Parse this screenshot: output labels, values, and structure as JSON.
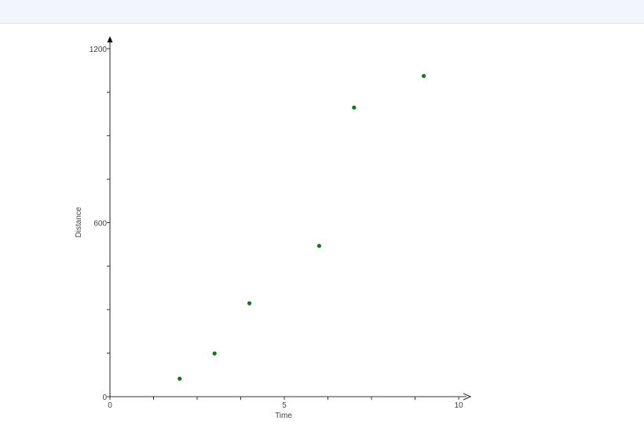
{
  "chart_data": {
    "type": "scatter",
    "title": "",
    "xlabel": "Time",
    "ylabel": "Distance",
    "xlim": [
      0,
      10
    ],
    "ylim": [
      0,
      1200
    ],
    "x_major_ticks": [
      0,
      5,
      10
    ],
    "x_minor_step": 1.25,
    "y_major_ticks": [
      0,
      600,
      1200
    ],
    "y_minor_step": 150,
    "grid": false,
    "point_color": "#0a7d0a",
    "points": [
      {
        "x": 2,
        "y": 62
      },
      {
        "x": 3,
        "y": 149
      },
      {
        "x": 4,
        "y": 322
      },
      {
        "x": 6,
        "y": 520
      },
      {
        "x": 7,
        "y": 997
      },
      {
        "x": 9,
        "y": 1106
      }
    ]
  }
}
